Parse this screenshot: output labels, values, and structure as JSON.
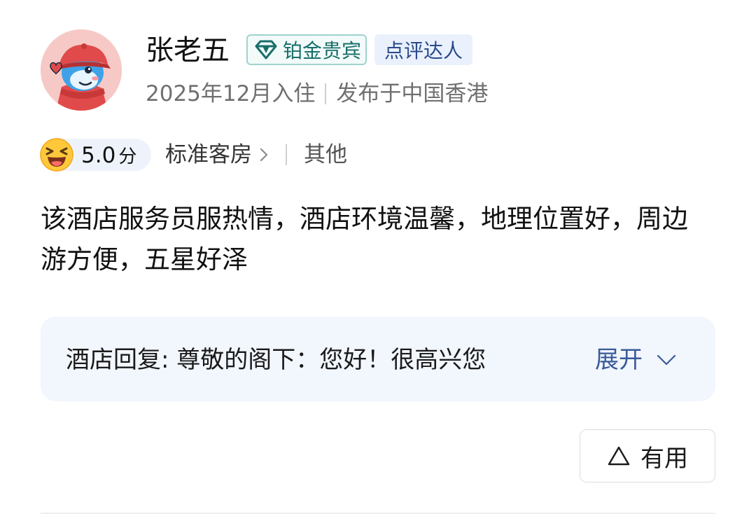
{
  "user": {
    "name": "张老五",
    "avatar_icon": "dolphin-avatar-icon",
    "badges": [
      {
        "label": "铂金贵宾",
        "icon": "diamond-icon",
        "color": "#176f6a"
      },
      {
        "label": "点评达人",
        "color": "#2b4a8a"
      }
    ],
    "stay_date": "2025年12月入住",
    "location": "发布于中国香港"
  },
  "rating": {
    "emoji_icon": "laughing-emoji-icon",
    "score": "5.0",
    "unit": "分",
    "room_type": "标准客房",
    "trip_type": "其他"
  },
  "review": {
    "text": "该酒店服务员服热情，酒店环境温馨，地理位置好，周边游方便，五星好泽"
  },
  "reply": {
    "text": "酒店回复: 尊敬的阁下：您好！很高兴您",
    "expand_label": "展开"
  },
  "actions": {
    "useful_label": "有用"
  },
  "colors": {
    "link_blue": "#3a5b99",
    "reply_background": "#f2f6fd",
    "platinum_teal": "#176f6a"
  }
}
